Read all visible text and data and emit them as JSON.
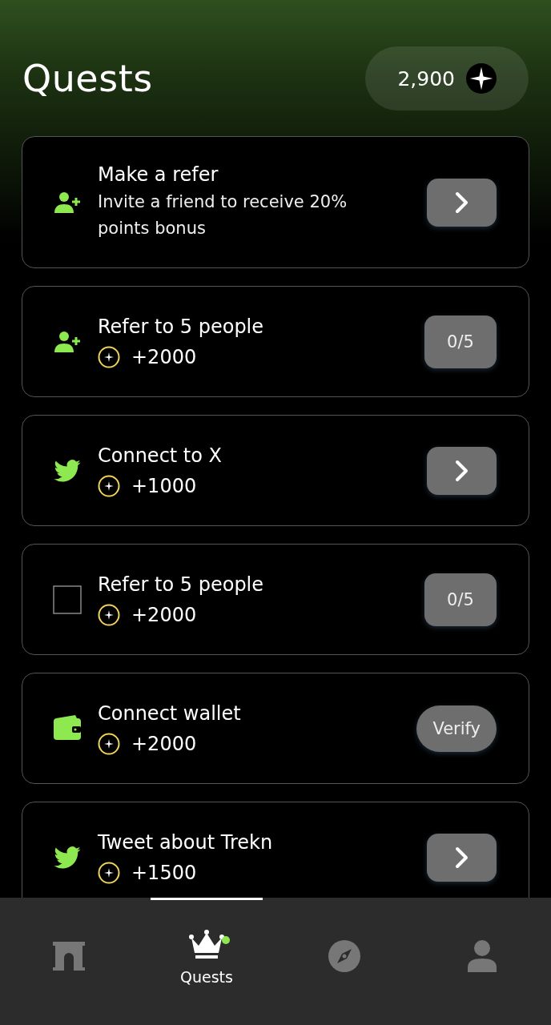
{
  "header": {
    "title": "Quests",
    "balance": "2,900"
  },
  "quests": [
    {
      "kind": "person-plus",
      "title": "Make a refer",
      "description": "Invite a friend to receive 20% points bonus",
      "action": {
        "kind": "arrow"
      }
    },
    {
      "kind": "person-plus",
      "title": "Refer to 5 people",
      "reward": "+2000",
      "action": {
        "kind": "text",
        "label": "0/5"
      }
    },
    {
      "kind": "bird",
      "title": "Connect to X",
      "reward": "+1000",
      "action": {
        "kind": "arrow"
      }
    },
    {
      "kind": "square",
      "title": "Refer to 5 people",
      "reward": "+2000",
      "action": {
        "kind": "text",
        "label": "0/5"
      }
    },
    {
      "kind": "wallet",
      "title": "Connect wallet",
      "reward": "+2000",
      "action": {
        "kind": "text",
        "label": "Verify"
      }
    },
    {
      "kind": "bird",
      "title": "Tweet about Trekn",
      "reward": "+1500",
      "action": {
        "kind": "arrow"
      }
    }
  ],
  "nav": [
    {
      "kind": "arch",
      "selected": false,
      "dot": false
    },
    {
      "kind": "crown",
      "label": "Quests",
      "selected": true,
      "dot": true
    },
    {
      "kind": "compass",
      "selected": false,
      "dot": false
    },
    {
      "kind": "person",
      "selected": false,
      "dot": false
    }
  ]
}
